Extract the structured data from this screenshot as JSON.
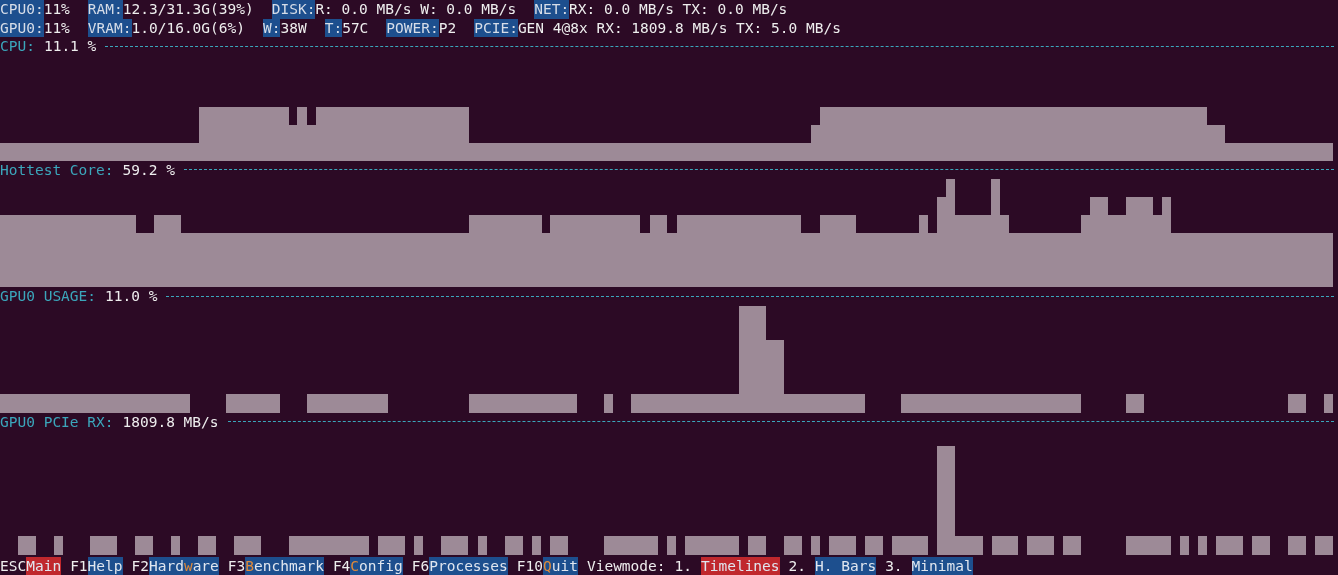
{
  "header_lines": [
    {
      "items": [
        {
          "label": "CPU0:",
          "value": "11%"
        },
        {
          "label": "RAM:",
          "value": "12.3/31.3G(39%)"
        },
        {
          "label": "DISK:",
          "value": "R: 0.0 MB/s W: 0.0 MB/s"
        },
        {
          "label": "NET:",
          "value": "RX: 0.0 MB/s TX: 0.0 MB/s"
        }
      ]
    },
    {
      "items": [
        {
          "label": "GPU0:",
          "value": "11%"
        },
        {
          "label": "VRAM:",
          "value": "1.0/16.0G(6%)"
        },
        {
          "label": "W:",
          "value": "38W"
        },
        {
          "label": "T:",
          "value": "57C"
        },
        {
          "label": "POWER:",
          "value": "P2"
        },
        {
          "label": "PCIE:",
          "value": "GEN 4@8x RX: 1809.8 MB/s TX: 5.0 MB/s"
        }
      ]
    }
  ],
  "panels": [
    {
      "title": "CPU:",
      "value": "11.1 %"
    },
    {
      "title": "Hottest Core:",
      "value": "59.2 %"
    },
    {
      "title": "GPU0 USAGE:",
      "value": "11.0 %"
    },
    {
      "title": "GPU0 PCIe RX:",
      "value": "1809.8 MB/s"
    }
  ],
  "footer": {
    "keys": [
      {
        "key": "ESC",
        "selected": true,
        "label": [
          {
            "text": "Main",
            "hot": false
          }
        ]
      },
      {
        "key": "F1",
        "selected": false,
        "label": [
          {
            "text": "Help",
            "hot": false
          }
        ]
      },
      {
        "key": "F2",
        "selected": false,
        "label": [
          {
            "text": "Hard",
            "hot": false
          },
          {
            "text": "w",
            "hot": true
          },
          {
            "text": "are",
            "hot": false
          }
        ]
      },
      {
        "key": "F3",
        "selected": false,
        "label": [
          {
            "text": "B",
            "hot": true
          },
          {
            "text": "enchmark",
            "hot": false
          }
        ]
      },
      {
        "key": "F4",
        "selected": false,
        "label": [
          {
            "text": "C",
            "hot": true
          },
          {
            "text": "onfig",
            "hot": false
          }
        ]
      },
      {
        "key": "F6",
        "selected": false,
        "label": [
          {
            "text": "Processes",
            "hot": false
          }
        ]
      },
      {
        "key": "F10",
        "selected": false,
        "label": [
          {
            "text": "Q",
            "hot": true
          },
          {
            "text": "uit",
            "hot": false
          }
        ]
      }
    ],
    "viewmode_label": "Viewmode:",
    "viewmodes": [
      {
        "number": "1.",
        "label": "Timelines",
        "selected": true
      },
      {
        "number": "2.",
        "label": "H. Bars",
        "selected": false
      },
      {
        "number": "3.",
        "label": "Minimal",
        "selected": false
      }
    ]
  }
}
